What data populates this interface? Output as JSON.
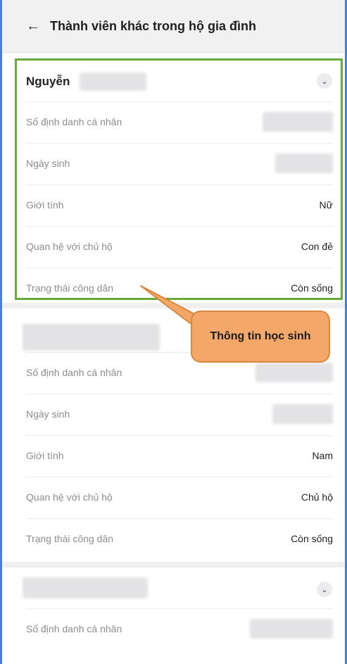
{
  "header": {
    "back_icon": "arrow-left-icon",
    "title": "Thành viên khác trong hộ gia đình"
  },
  "members": [
    {
      "name": "Nguyễn",
      "rows": [
        {
          "label": "Số định danh cá nhân",
          "value": ""
        },
        {
          "label": "Ngày sinh",
          "value": ""
        },
        {
          "label": "Giới tính",
          "value": "Nữ"
        },
        {
          "label": "Quan hệ với chủ hộ",
          "value": "Con đẻ"
        },
        {
          "label": "Trạng thái công dân",
          "value": "Còn sống"
        }
      ]
    },
    {
      "name": "",
      "rows": [
        {
          "label": "Số định danh cá nhân",
          "value": ""
        },
        {
          "label": "Ngày sinh",
          "value": ""
        },
        {
          "label": "Giới tính",
          "value": "Nam"
        },
        {
          "label": "Quan hệ với chủ hộ",
          "value": "Chủ hộ"
        },
        {
          "label": "Trạng thái công dân",
          "value": "Còn sống"
        }
      ]
    },
    {
      "name": "",
      "rows": [
        {
          "label": "Số định danh cá nhân",
          "value": ""
        }
      ]
    }
  ],
  "annotation": {
    "text": "Thông tin học sinh"
  },
  "colors": {
    "highlight_border": "#6aaa3a",
    "callout_fill": "#f3a86a",
    "frame_border": "#4a7fd4"
  }
}
